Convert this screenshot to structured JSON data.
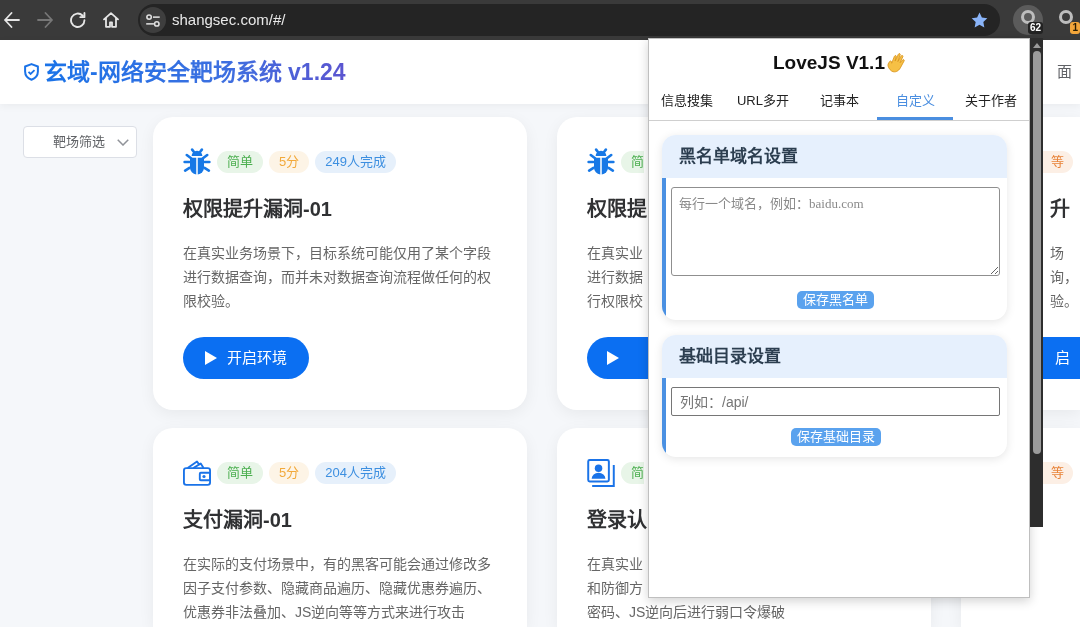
{
  "browser": {
    "nav_buttons": [
      {
        "kind": "back",
        "disabled": false
      },
      {
        "kind": "forward",
        "disabled": true
      },
      {
        "kind": "reload",
        "disabled": false
      },
      {
        "kind": "home",
        "disabled": false
      }
    ],
    "url": "shangsec.com/#/",
    "bookmarked": true,
    "extensions": [
      {
        "badge": "62",
        "color": "#222222",
        "active": true
      },
      {
        "badge": "1",
        "color": "#f2a53a",
        "active": false
      }
    ]
  },
  "header": {
    "title": "玄域-网络安全靶场系统 v1.24",
    "nav_link": "面"
  },
  "filter": {
    "label": "靶场筛选"
  },
  "cards": [
    {
      "kind": "vuln",
      "badges": [
        {
          "text": "简单",
          "color": "#4caf50"
        },
        {
          "text": "5分",
          "color": "#f2a93b"
        },
        {
          "text": "249人完成",
          "color": "#3d8fe0"
        }
      ],
      "title": "权限提升漏洞-01",
      "description": "在真实业务场景下，目标系统可能仅用了某个字段进行数据查询，而并未对数据查询流程做任何的权限校验。",
      "button_label": "开启环境"
    },
    {
      "kind": "vuln",
      "badges": [
        {
          "text": "简",
          "color": "#4caf50"
        }
      ],
      "title": "权限提",
      "lines": [
        "在真实业",
        "进行数据",
        "行权限校"
      ],
      "has_button": true
    },
    {
      "badges": [
        {
          "text": "等",
          "color": "#e8843a"
        }
      ],
      "title": "升",
      "lines": [
        "场",
        "询，",
        "验。"
      ],
      "button_label": "启"
    },
    {
      "kind": "payment",
      "badges": [
        {
          "text": "简单",
          "color": "#4caf50"
        },
        {
          "text": "5分",
          "color": "#f2a93b"
        },
        {
          "text": "204人完成",
          "color": "#3d8fe0"
        }
      ],
      "title": "支付漏洞-01",
      "description": "在实际的支付场景中，有的黑客可能会通过修改多因子支付参数、隐藏商品遍历、隐藏优惠券遍历、优惠券非法叠加、JS逆向等等方式来进行攻击"
    },
    {
      "kind": "auth",
      "badges": [
        {
          "text": "简",
          "color": "#4caf50"
        }
      ],
      "title": "登录认",
      "lines": [
        "在真实业",
        "和防御方",
        "密码、JS逆向后进行弱口令爆破"
      ]
    },
    {
      "badges": [
        {
          "text": "等",
          "color": "#e8843a"
        }
      ]
    }
  ],
  "popup": {
    "title": "LoveJS V1.1",
    "tabs": [
      {
        "label": "信息搜集",
        "selected": false
      },
      {
        "label": "URL多开",
        "selected": false
      },
      {
        "label": "记事本",
        "selected": false
      },
      {
        "label": "自定义",
        "selected": true
      },
      {
        "label": "关于作者",
        "selected": false
      }
    ],
    "sections": [
      {
        "kind": "textarea",
        "title": "黑名单域名设置",
        "placeholder": "每行一个域名，例如：baidu.com",
        "button": "保存黑名单"
      },
      {
        "kind": "input",
        "title": "基础目录设置",
        "placeholder": "列如：/api/",
        "button": "保存基础目录"
      }
    ]
  }
}
